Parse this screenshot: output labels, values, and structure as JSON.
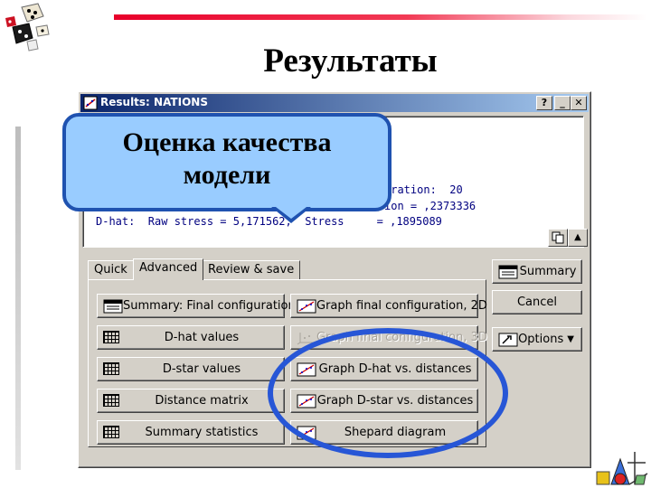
{
  "slide": {
    "title": "Результаты"
  },
  "window": {
    "title": "Results: NATIONS",
    "controls": {
      "help": "?",
      "minimize": "_",
      "close": "✕"
    }
  },
  "output": {
    "line1": "eration:  20",
    "line2": "ion = ,2373336",
    "line3": "D-hat:  Raw stress = 5,171562;  Stress     = ,1895089"
  },
  "tabs": [
    {
      "label": "Quick"
    },
    {
      "label": "Advanced"
    },
    {
      "label": "Review & save"
    }
  ],
  "buttons_left": [
    {
      "label": "Summary: Final configuration",
      "icon": "summary-icon"
    },
    {
      "label": "D-hat values",
      "icon": "grid-icon"
    },
    {
      "label": "D-star values",
      "icon": "grid-icon"
    },
    {
      "label": "Distance matrix",
      "icon": "grid-icon"
    },
    {
      "label": "Summary statistics",
      "icon": "grid-icon"
    }
  ],
  "buttons_right": [
    {
      "label": "Graph final configuration, 2D",
      "icon": "scatter-graph-icon"
    },
    {
      "label": "Graph final configuration, 3D",
      "icon": "3d-graph-icon",
      "disabled": true
    },
    {
      "label": "Graph D-hat vs. distances",
      "icon": "scatter-graph-icon"
    },
    {
      "label": "Graph D-star vs. distances",
      "icon": "scatter-graph-icon"
    },
    {
      "label": "Shepard diagram",
      "icon": "scatter-graph-icon"
    }
  ],
  "side_buttons": {
    "summary": "Summary",
    "cancel": "Cancel",
    "options": "Options",
    "summary_icon_text": "SUMM"
  },
  "callout": {
    "line1": "Оценка качества",
    "line2": "модели"
  },
  "colors": {
    "title_rule": "#e8002a",
    "callout_fill": "#99ccff",
    "callout_border": "#1f52b0",
    "highlight_ellipse": "#2756d6"
  }
}
